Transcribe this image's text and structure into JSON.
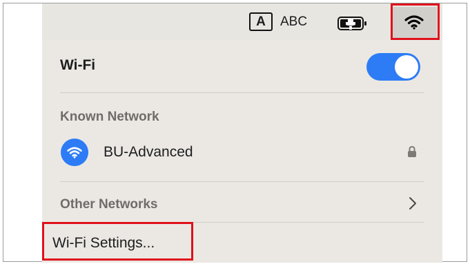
{
  "menubar": {
    "input_source_badge": "A",
    "input_source_name": "ABC",
    "icons": [
      "battery-charging-icon",
      "wifi-icon"
    ]
  },
  "panel": {
    "title": "Wi-Fi",
    "wifi_enabled": true,
    "known_network_label": "Known Network",
    "known_networks": [
      {
        "name": "BU-Advanced",
        "icon": "wifi-icon",
        "secured": true
      }
    ],
    "other_networks_label": "Other Networks",
    "settings_label": "Wi-Fi Settings..."
  },
  "colors": {
    "accent": "#2d7cf6",
    "highlight_box": "#e0101b",
    "menubar_bg": "#e8e6e1",
    "panel_bg": "#ebe8e3"
  }
}
